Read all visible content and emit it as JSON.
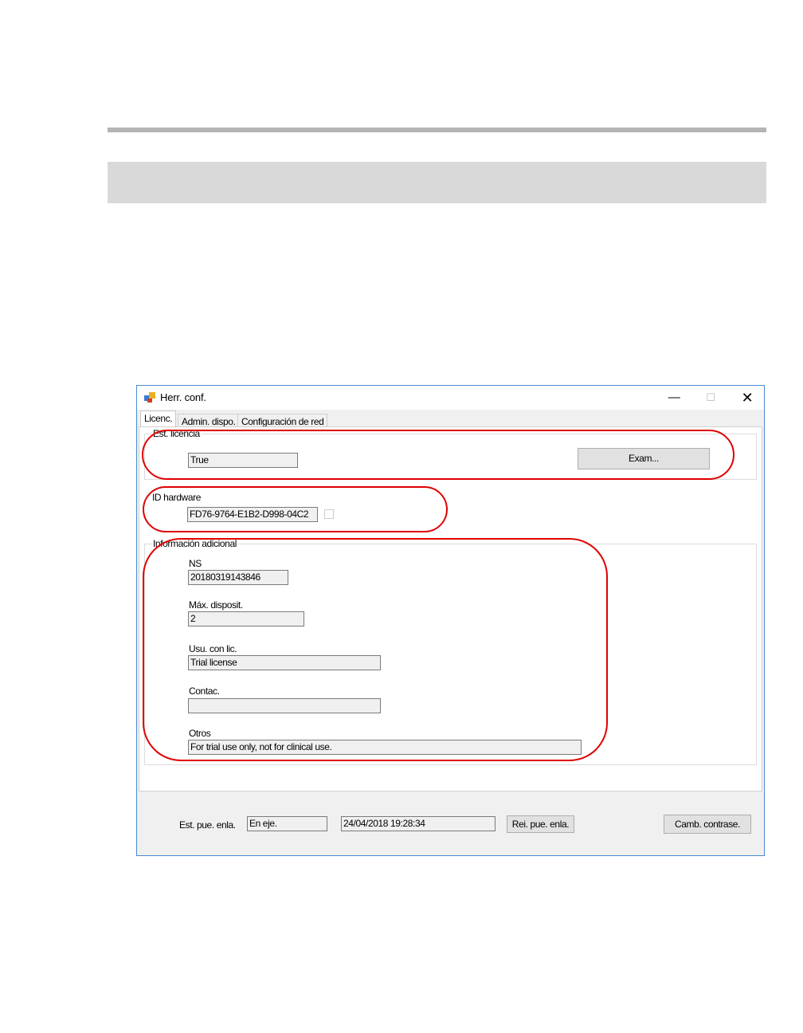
{
  "window": {
    "title": "Herr. conf.",
    "minimize_glyph": "—",
    "maximize_glyph": "☐",
    "close_glyph": "✕"
  },
  "tabs": [
    {
      "label": "Licenc.",
      "active": true
    },
    {
      "label": "Admin. dispo.",
      "active": false
    },
    {
      "label": "Configuración de red",
      "active": false
    }
  ],
  "license_status": {
    "group_label": "Est. licencia",
    "value": "True",
    "browse_button": "Exam..."
  },
  "hardware_id": {
    "group_label": "ID hardware",
    "value": "FD76-9764-E1B2-D998-04C2",
    "checkbox_checked": false
  },
  "additional_info": {
    "group_label": "Información adicional",
    "fields": [
      {
        "label": "NS",
        "value": "20180319143846"
      },
      {
        "label": "Máx. disposit.",
        "value": "2"
      },
      {
        "label": "Usu. con lic.",
        "value": "Trial license"
      },
      {
        "label": "Contac.",
        "value": ""
      },
      {
        "label": "Otros",
        "value": "For trial use only, not for clinical use."
      }
    ]
  },
  "footer": {
    "link_port_status_label": "Est. pue. enla.",
    "link_port_status_value": "En eje.",
    "timestamp": "24/04/2018 19:28:34",
    "restart_port_button": "Rei. pue. enla.",
    "change_password_button": "Camb. contrase."
  },
  "colors": {
    "highlight_oval": "#e00000",
    "window_border": "#4a8ad4"
  }
}
